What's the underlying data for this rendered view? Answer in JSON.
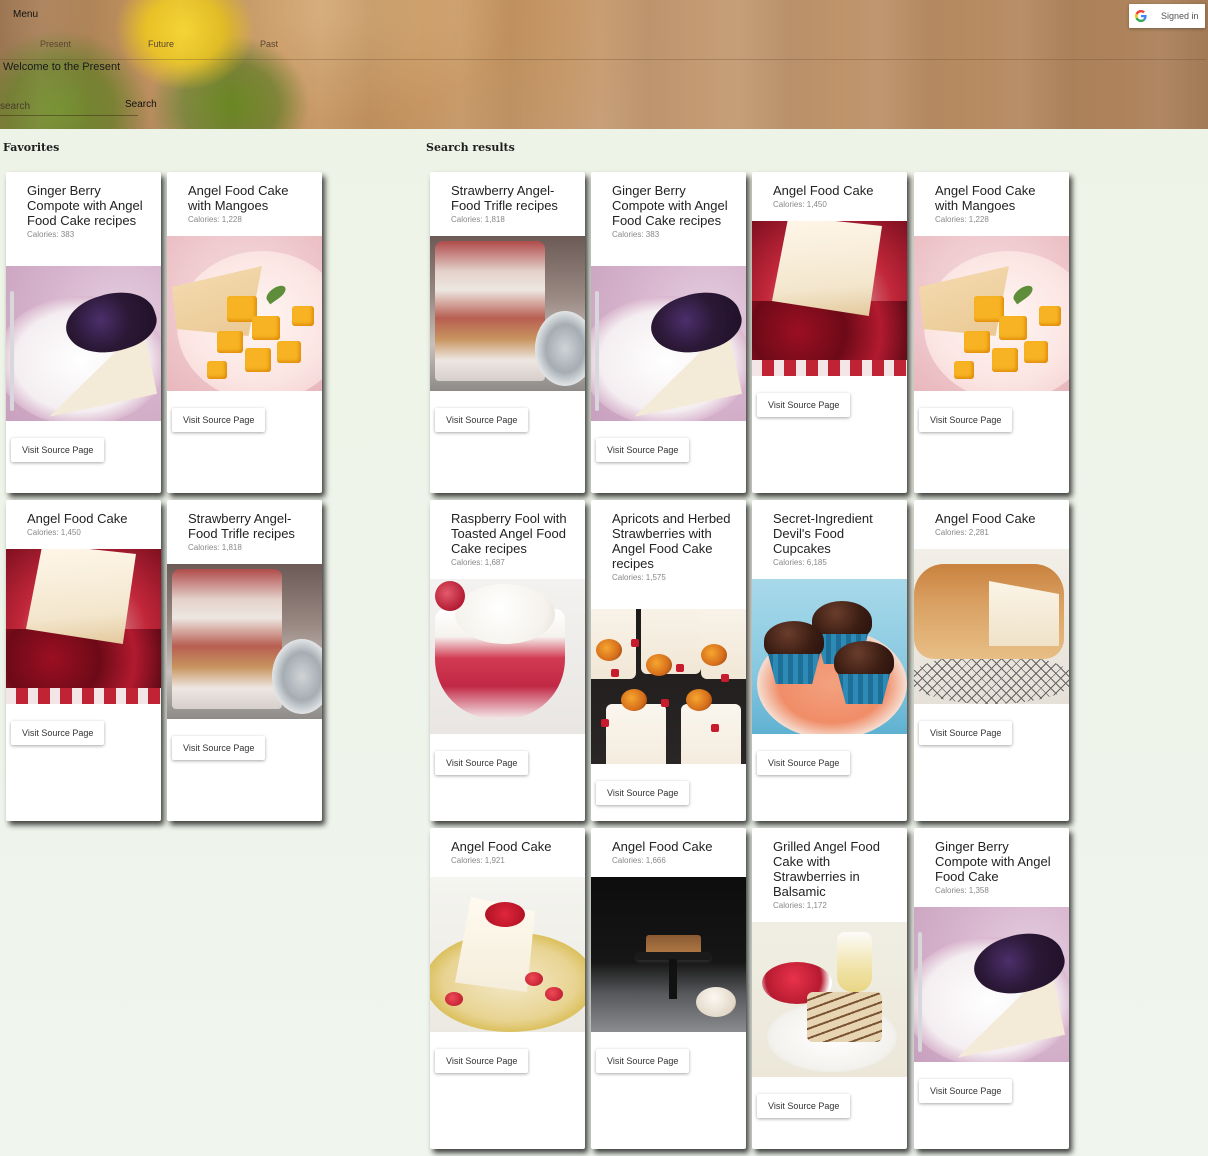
{
  "header": {
    "menu_label": "Menu",
    "nav": [
      "Present",
      "Future",
      "Past"
    ],
    "welcome": "Welcome to the Present",
    "search": {
      "placeholder": "search",
      "value": "",
      "button": "Search"
    },
    "signin": {
      "label": "Signed in",
      "icon": "google-icon"
    }
  },
  "favorites": {
    "title": "Favorites",
    "cards": [
      {
        "title": "Ginger Berry Compote with Angel Food Cake recipes",
        "calories": "Calories: 383",
        "image": "berry-compote-cake",
        "button": "Visit Source Page"
      },
      {
        "title": "Angel Food Cake with Mangoes",
        "calories": "Calories: 1,228",
        "image": "mango-cake",
        "button": "Visit Source Page"
      },
      {
        "title": "Angel Food Cake",
        "calories": "Calories: 1,450",
        "image": "cake-berry-sauce",
        "button": "Visit Source Page"
      },
      {
        "title": "Strawberry Angel-Food Trifle recipes",
        "calories": "Calories: 1,818",
        "image": "trifle",
        "button": "Visit Source Page"
      }
    ]
  },
  "results": {
    "title": "Search results",
    "cards": [
      {
        "title": "Strawberry Angel-Food Trifle recipes",
        "calories": "Calories: 1,818",
        "image": "trifle",
        "button": "Visit Source Page"
      },
      {
        "title": "Ginger Berry Compote with Angel Food Cake recipes",
        "calories": "Calories: 383",
        "image": "berry-compote-cake",
        "button": "Visit Source Page"
      },
      {
        "title": "Angel Food Cake",
        "calories": "Calories: 1,450",
        "image": "cake-berry-sauce",
        "button": "Visit Source Page"
      },
      {
        "title": "Angel Food Cake with Mangoes",
        "calories": "Calories: 1,228",
        "image": "mango-cake",
        "button": "Visit Source Page"
      },
      {
        "title": "Raspberry Fool with Toasted Angel Food Cake recipes",
        "calories": "Calories: 1,687",
        "image": "raspberry-fool",
        "button": "Visit Source Page"
      },
      {
        "title": "Apricots and Herbed Strawberries with Angel Food Cake recipes",
        "calories": "Calories: 1,575",
        "image": "apricots-strawberries",
        "button": "Visit Source Page"
      },
      {
        "title": "Secret-Ingredient Devil's Food Cupcakes",
        "calories": "Calories: 6,185",
        "image": "chocolate-cupcakes",
        "button": "Visit Source Page"
      },
      {
        "title": "Angel Food Cake",
        "calories": "Calories: 2,281",
        "image": "chiffon-cake",
        "button": "Visit Source Page"
      },
      {
        "title": "Angel Food Cake",
        "calories": "Calories: 1,921",
        "image": "cake-slice-strawberries",
        "button": "Visit Source Page"
      },
      {
        "title": "Angel Food Cake",
        "calories": "Calories: 1,666",
        "image": "cake-on-stand",
        "button": "Visit Source Page"
      },
      {
        "title": "Grilled Angel Food Cake with Strawberries in Balsamic",
        "calories": "Calories: 1,172",
        "image": "grilled-cake",
        "button": "Visit Source Page"
      },
      {
        "title": "Ginger Berry Compote with Angel Food Cake",
        "calories": "Calories: 1,358",
        "image": "berry-compote-cake",
        "button": "Visit Source Page"
      }
    ]
  }
}
